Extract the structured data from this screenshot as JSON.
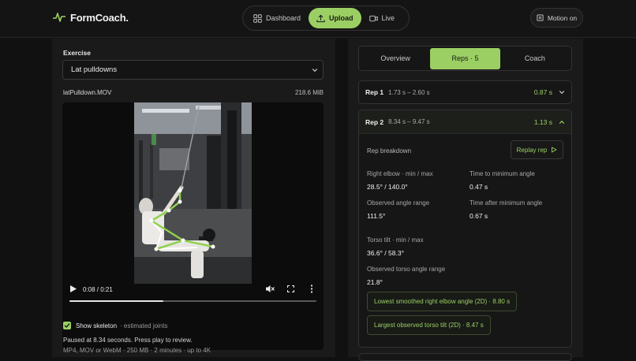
{
  "app": {
    "name": "FormCoach."
  },
  "nav": {
    "dashboard": "Dashboard",
    "upload": "Upload",
    "live": "Live"
  },
  "motion_label": "Motion on",
  "exercise": {
    "label": "Exercise",
    "selected": "Lat pulldowns",
    "file_name": "latPulldown.MOV",
    "file_size": "218.6 MiB"
  },
  "player": {
    "time": "0:08 / 0:21",
    "progress": 0.38
  },
  "skeleton": {
    "label": "Show skeleton",
    "note": "· estimated joints",
    "checked": true
  },
  "status": {
    "paused": "Paused at 8.34 seconds. Press play to review.",
    "formats": "MP4, MOV or WebM · 250 MB · 2 minutes · up to 4K"
  },
  "tabs": [
    "Overview",
    "Reps · 5",
    "Coach"
  ],
  "reps": [
    {
      "title": "Rep 1",
      "range": "1.73 s – 2.60 s",
      "duration": "0.87 s"
    },
    {
      "title": "Rep 2",
      "range": "8.34 s – 9.47 s",
      "duration": "1.13 s"
    }
  ],
  "breakdown": {
    "heading": "Rep breakdown",
    "replay": "Replay rep",
    "metrics": {
      "elbow_label": "Right elbow · min / max",
      "elbow_value": "28.5° / 140.0°",
      "time_min_label": "Time to minimum angle",
      "time_min_value": "0.47 s",
      "range_label": "Observed angle range",
      "range_value": "111.5°",
      "time_after_label": "Time after minimum angle",
      "time_after_value": "0.67 s",
      "torso_label": "Torso tilt · min / max",
      "torso_value": "36.6° / 58.3°",
      "torso_range_label": "Observed torso angle range",
      "torso_range_value": "21.8°"
    },
    "chips": [
      "Lowest smoothed right elbow angle (2D) · 8.80 s",
      "Largest observed torso tilt (2D) · 8.47 s"
    ]
  },
  "colors": {
    "accent": "#9bcf63",
    "background": "#111111",
    "panel": "#1a1a1a"
  }
}
